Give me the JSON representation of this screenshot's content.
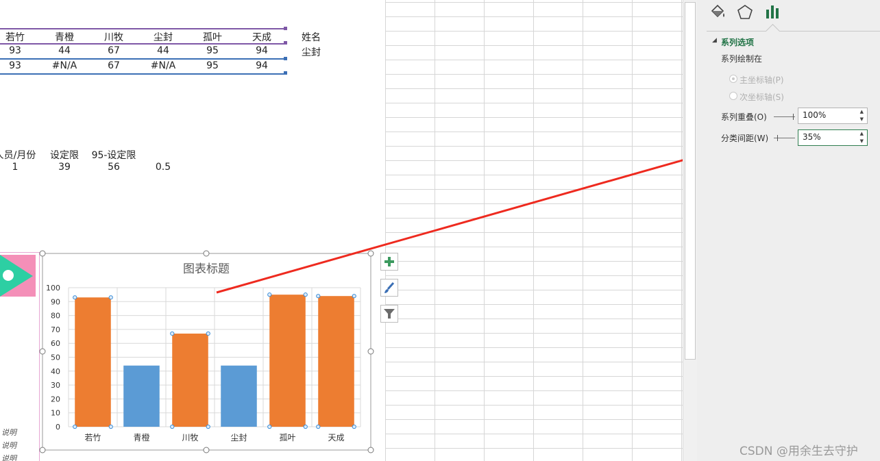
{
  "table1": {
    "names": [
      "若竹",
      "青橙",
      "川牧",
      "尘封",
      "孤叶",
      "天成"
    ],
    "row1": [
      "93",
      "44",
      "67",
      "44",
      "95",
      "94"
    ],
    "row2": [
      "93",
      "#N/A",
      "67",
      "#N/A",
      "95",
      "94"
    ],
    "side_label": "姓名",
    "side_value": "尘封"
  },
  "table2": {
    "headers": [
      "人员/月份",
      "设定限",
      "95-设定限"
    ],
    "values": [
      "1",
      "39",
      "56",
      "0.5"
    ]
  },
  "notes": [
    "说明",
    "说明",
    "说明"
  ],
  "chart_data": {
    "type": "bar",
    "title": "图表标题",
    "categories": [
      "若竹",
      "青橙",
      "川牧",
      "尘封",
      "孤叶",
      "天成"
    ],
    "series": [
      {
        "values": [
          93,
          null,
          67,
          null,
          95,
          94
        ],
        "color": "#ed7d31"
      },
      {
        "values": [
          null,
          44,
          null,
          44,
          null,
          null
        ],
        "color": "#5b9bd5"
      }
    ],
    "yticks": [
      0,
      10,
      20,
      30,
      40,
      50,
      60,
      70,
      80,
      90,
      100
    ],
    "ylim": [
      0,
      100
    ],
    "grid": true
  },
  "chart_buttons": [
    "plus-icon",
    "brush-icon",
    "filter-icon"
  ],
  "pane": {
    "section_title": "系列选项",
    "plot_on_label": "系列绘制在",
    "primary_axis": "主坐标轴(P)",
    "secondary_axis": "次坐标轴(S)",
    "overlap_label": "系列重叠(O)",
    "overlap_value": "100%",
    "gap_label": "分类间距(W)",
    "gap_value": "35%",
    "accent_color": "#217346"
  },
  "watermark": "CSDN @用余生去守护"
}
